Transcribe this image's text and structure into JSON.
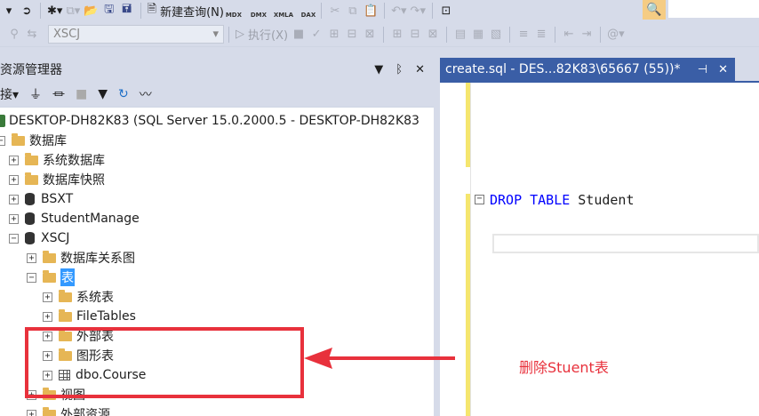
{
  "toolbar": {
    "new_query_label": "新建查询(N)",
    "mdx_label": "MDX",
    "dmx_label": "DMX",
    "xmla_label": "XMLA",
    "dax_label": "DAX",
    "database_select_value": "XSCJ",
    "execute_label": "执行(X)"
  },
  "object_explorer": {
    "title": "资源管理器",
    "connect_label": "接",
    "pin_glyph": "▼ ᛒ ✕"
  },
  "tree": {
    "server": "DESKTOP-DH82K83 (SQL Server 15.0.2000.5 - DESKTOP-DH82K83",
    "databases": "数据库",
    "system_databases": "系统数据库",
    "db_snapshots": "数据库快照",
    "db_bsxt": "BSXT",
    "db_studentmanage": "StudentManage",
    "db_xscj": "XSCJ",
    "diagrams": "数据库关系图",
    "tables": "表",
    "system_tables": "系统表",
    "file_tables": "FileTables",
    "external_tables": "外部表",
    "graph_tables": "图形表",
    "dbo_course": "dbo.Course",
    "views": "视图",
    "external_resources": "外部资源"
  },
  "editor": {
    "tab_title": "create.sql - DES...82K83\\65667 (55))*",
    "code_kw1": "DROP",
    "code_kw2": "TABLE",
    "code_ident": "Student"
  },
  "annotation": {
    "text": "删除Stuent表",
    "color": "#e8313c"
  },
  "colors": {
    "chrome": "#d6dbe9",
    "tab_active": "#3a5ea6",
    "selection": "#3399ff",
    "keyword": "#0000ff"
  }
}
